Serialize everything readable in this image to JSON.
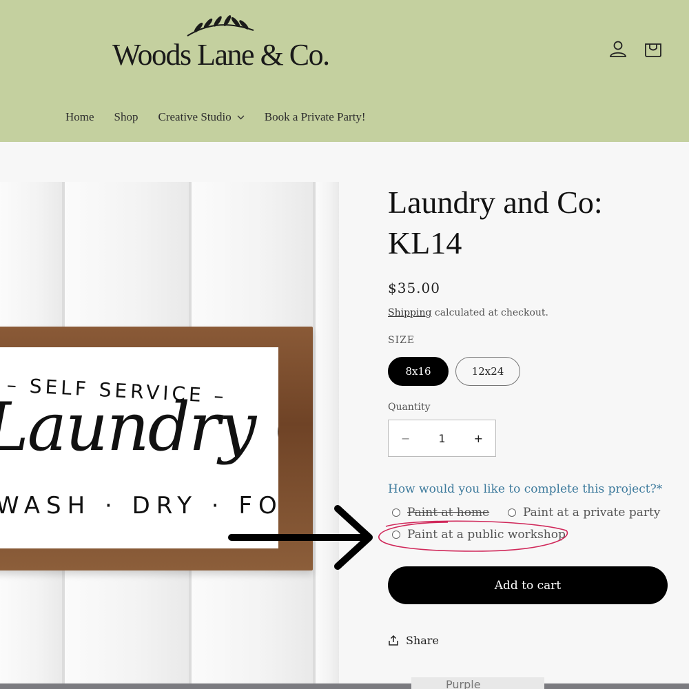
{
  "brand": {
    "name": "Woods Lane & Co."
  },
  "header": {
    "icons": [
      "account-icon",
      "cart-icon"
    ],
    "nav": [
      {
        "label": "Home"
      },
      {
        "label": "Shop"
      },
      {
        "label": "Creative Studio"
      },
      {
        "label": "Book a Private Party!"
      }
    ]
  },
  "gallery": {
    "sign": {
      "top": "– SELF SERVICE –",
      "main": "Laundry Co.",
      "bottom": "WASH · DRY · FOLD"
    }
  },
  "product": {
    "title_line1": "Laundry and Co:",
    "title_line2": "KL14",
    "price": "$35.00",
    "shipping_link": "Shipping",
    "shipping_rest": "calculated at checkout.",
    "size_label": "SIZE",
    "sizes": [
      {
        "label": "8x16",
        "selected": true
      },
      {
        "label": "12x24",
        "selected": false
      }
    ],
    "quantity_label": "Quantity",
    "quantity_value": "1",
    "decrement": "−",
    "increment": "+",
    "question": "How would you like to complete this project?*",
    "options": [
      {
        "label": "Paint at home"
      },
      {
        "label": "Paint at a private party"
      },
      {
        "label": "Paint at a public workshop"
      }
    ],
    "add_to_cart": "Add to cart",
    "share": "Share"
  },
  "bottom_tab": {
    "label": "Purple"
  },
  "colors": {
    "header_bg": "#c4d09f",
    "accent_link": "#3d7a9c",
    "annotation_circle": "#d0285a",
    "button_bg": "#000000"
  }
}
